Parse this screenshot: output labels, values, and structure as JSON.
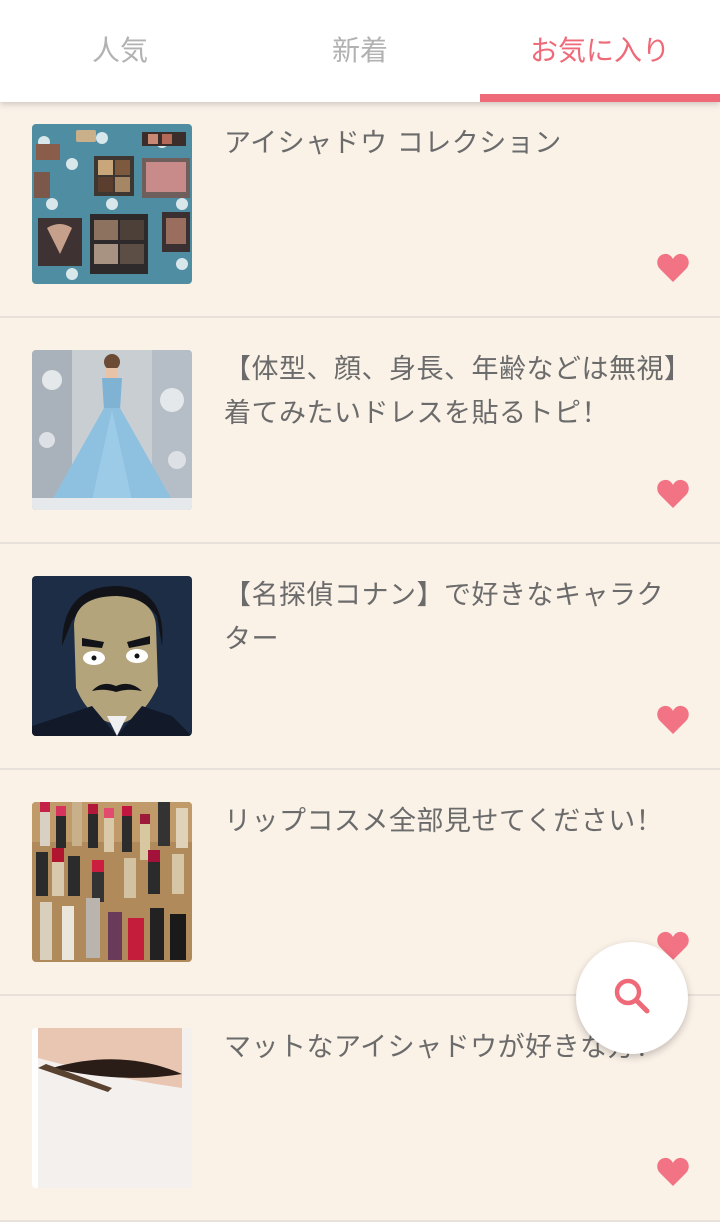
{
  "tabs": [
    {
      "label": "人気",
      "active": false
    },
    {
      "label": "新着",
      "active": false
    },
    {
      "label": "お気に入り",
      "active": true
    }
  ],
  "colors": {
    "accent": "#ef6a78",
    "background": "#faf1e7",
    "text": "#6b6b6b",
    "tab_inactive": "#b2b2b2"
  },
  "items": [
    {
      "title": "アイシャドウ コレクション",
      "favorited": true,
      "thumbnail": "eyeshadow-palettes-photo"
    },
    {
      "title": "【体型、顔、身長、年齢などは無視】着てみたいドレスを貼るトピ！",
      "favorited": true,
      "thumbnail": "blue-ballgown-dress-photo"
    },
    {
      "title": "【名探偵コナン】で好きなキャラクター",
      "favorited": true,
      "thumbnail": "anime-character-mustache-image"
    },
    {
      "title": "リップコスメ全部見せてください！",
      "favorited": true,
      "thumbnail": "lipstick-collection-photo"
    },
    {
      "title": "マットなアイシャドウが好きな方！",
      "favorited": true,
      "thumbnail": "eye-makeup-closeup-photo"
    }
  ],
  "fab": {
    "icon": "search-icon"
  }
}
